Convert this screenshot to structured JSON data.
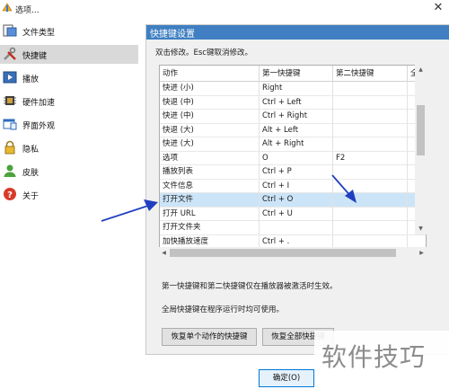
{
  "window": {
    "title": "选项..."
  },
  "sidebar": {
    "items": [
      {
        "label": "文件类型",
        "icon": "file-types-icon",
        "active": false
      },
      {
        "label": "快捷键",
        "icon": "shortcut-tools-icon",
        "active": true
      },
      {
        "label": "播放",
        "icon": "play-icon",
        "active": false
      },
      {
        "label": "硬件加速",
        "icon": "chip-icon",
        "active": false
      },
      {
        "label": "界面外观",
        "icon": "window-appearance-icon",
        "active": false
      },
      {
        "label": "隐私",
        "icon": "lock-icon",
        "active": false
      },
      {
        "label": "皮肤",
        "icon": "user-skin-icon",
        "active": false
      },
      {
        "label": "关于",
        "icon": "help-icon",
        "active": false
      }
    ]
  },
  "panel": {
    "title": "快捷键设置",
    "hint": "双击修改。Esc键取消修改。"
  },
  "table": {
    "headers": [
      "动作",
      "第一快捷键",
      "第二快捷键",
      "全局"
    ],
    "rows": [
      [
        "快进 (小)",
        "Right",
        "",
        ""
      ],
      [
        "快退 (中)",
        "Ctrl + Left",
        "",
        ""
      ],
      [
        "快进 (中)",
        "Ctrl + Right",
        "",
        ""
      ],
      [
        "快退 (大)",
        "Alt + Left",
        "",
        ""
      ],
      [
        "快进 (大)",
        "Alt + Right",
        "",
        ""
      ],
      [
        "选项",
        "O",
        "F2",
        ""
      ],
      [
        "播放列表",
        "Ctrl + P",
        "",
        ""
      ],
      [
        "文件信息",
        "Ctrl + I",
        "",
        ""
      ],
      [
        "打开文件",
        "Ctrl + O",
        "",
        ""
      ],
      [
        "打开 URL",
        "Ctrl + U",
        "",
        ""
      ],
      [
        "打开文件夹",
        "",
        "",
        ""
      ],
      [
        "加快播放速度",
        "Ctrl + .",
        "",
        ""
      ]
    ],
    "selected_row": 8
  },
  "notes": {
    "line1": "第一快捷键和第二快捷键仅在播放器被激活时生效。",
    "line2": "全局快捷键在程序运行时均可使用。"
  },
  "buttons": {
    "restore_single": "恢复单个动作的快捷键",
    "restore_all": "恢复全部快捷键",
    "ok": "确定(O)"
  },
  "watermark": "软件技巧",
  "colors": {
    "header_blue": "#3f7fc2",
    "selected_row": "#cce4f7",
    "arrow": "#1f3fbf"
  }
}
